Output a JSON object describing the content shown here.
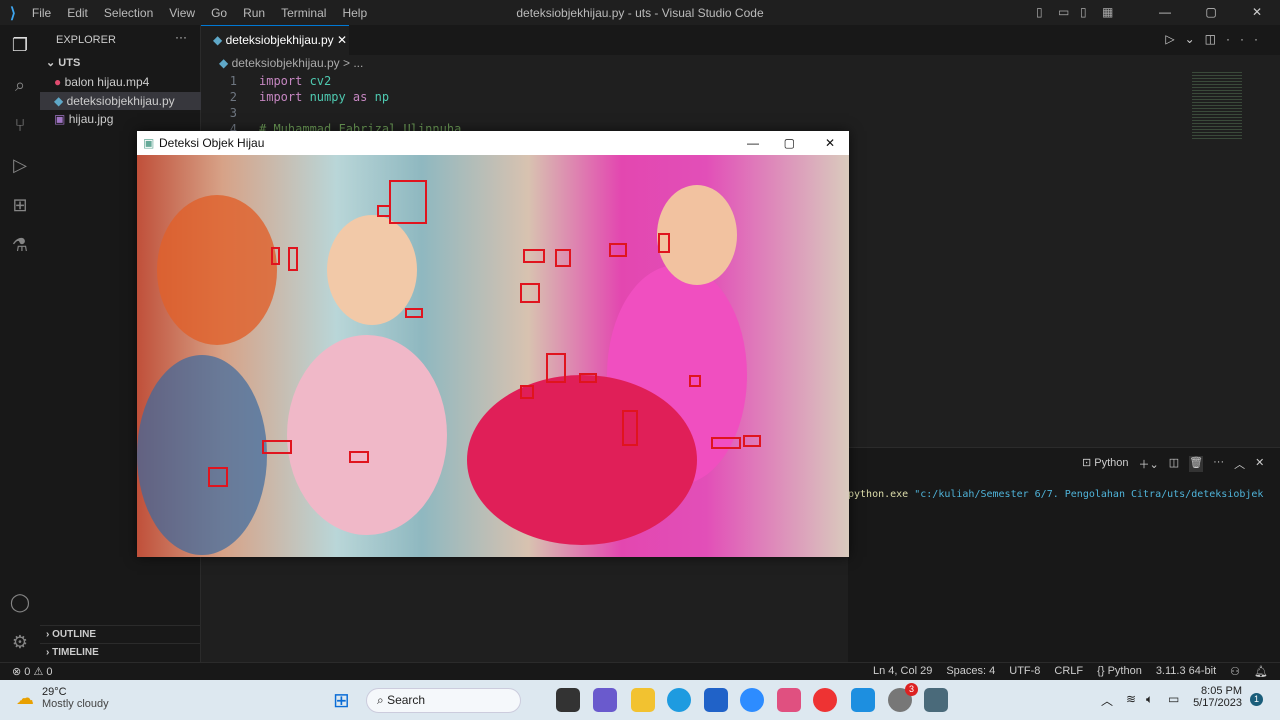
{
  "window_title": "deteksiobjekhijau.py - uts - Visual Studio Code",
  "menu": [
    "File",
    "Edit",
    "Selection",
    "View",
    "Go",
    "Run",
    "Terminal",
    "Help"
  ],
  "sidebar": {
    "header": "EXPLORER",
    "folder": "UTS",
    "files": [
      {
        "name": "balon hijau.mp4",
        "icon": "video-icon"
      },
      {
        "name": "deteksiobjekhijau.py",
        "icon": "python-icon"
      },
      {
        "name": "hijau.jpg",
        "icon": "image-icon"
      }
    ],
    "outline": "OUTLINE",
    "timeline": "TIMELINE"
  },
  "tab": {
    "label": "deteksiobjekhijau.py"
  },
  "breadcrumb": {
    "file": "deteksiobjekhijau.py",
    "rest": "> ..."
  },
  "code": [
    {
      "n": "1",
      "parts": [
        {
          "t": "import ",
          "c": "kw"
        },
        {
          "t": "cv2",
          "c": "mod"
        }
      ]
    },
    {
      "n": "2",
      "parts": [
        {
          "t": "import ",
          "c": "kw"
        },
        {
          "t": "numpy",
          "c": "mod"
        },
        {
          "t": " as ",
          "c": "kw"
        },
        {
          "t": "np",
          "c": "mod"
        }
      ]
    },
    {
      "n": "3",
      "parts": []
    },
    {
      "n": "4",
      "parts": [
        {
          "t": "# Muhammad Fabrizal Ulinnuha",
          "c": "cm"
        }
      ]
    }
  ],
  "popup": {
    "title": "Deteksi Objek Hijau"
  },
  "terminal": {
    "profile": "Python",
    "command_exe": "python.exe",
    "command_arg": "\"c:/kuliah/Semester 6/7. Pengolahan Citra/uts/deteksiobjek"
  },
  "status": {
    "errors": "0",
    "warnings": "0",
    "position": "Ln 4, Col 29",
    "spaces": "Spaces: 4",
    "encoding": "UTF-8",
    "eol": "CRLF",
    "language": "Python",
    "interpreter": "3.11.3 64-bit"
  },
  "taskbar": {
    "temp": "29°C",
    "weather": "Mostly cloudy",
    "search": "Search",
    "time": "8:05 PM",
    "date": "5/17/2023",
    "notif": "1",
    "whatsapp_badge": "3"
  }
}
